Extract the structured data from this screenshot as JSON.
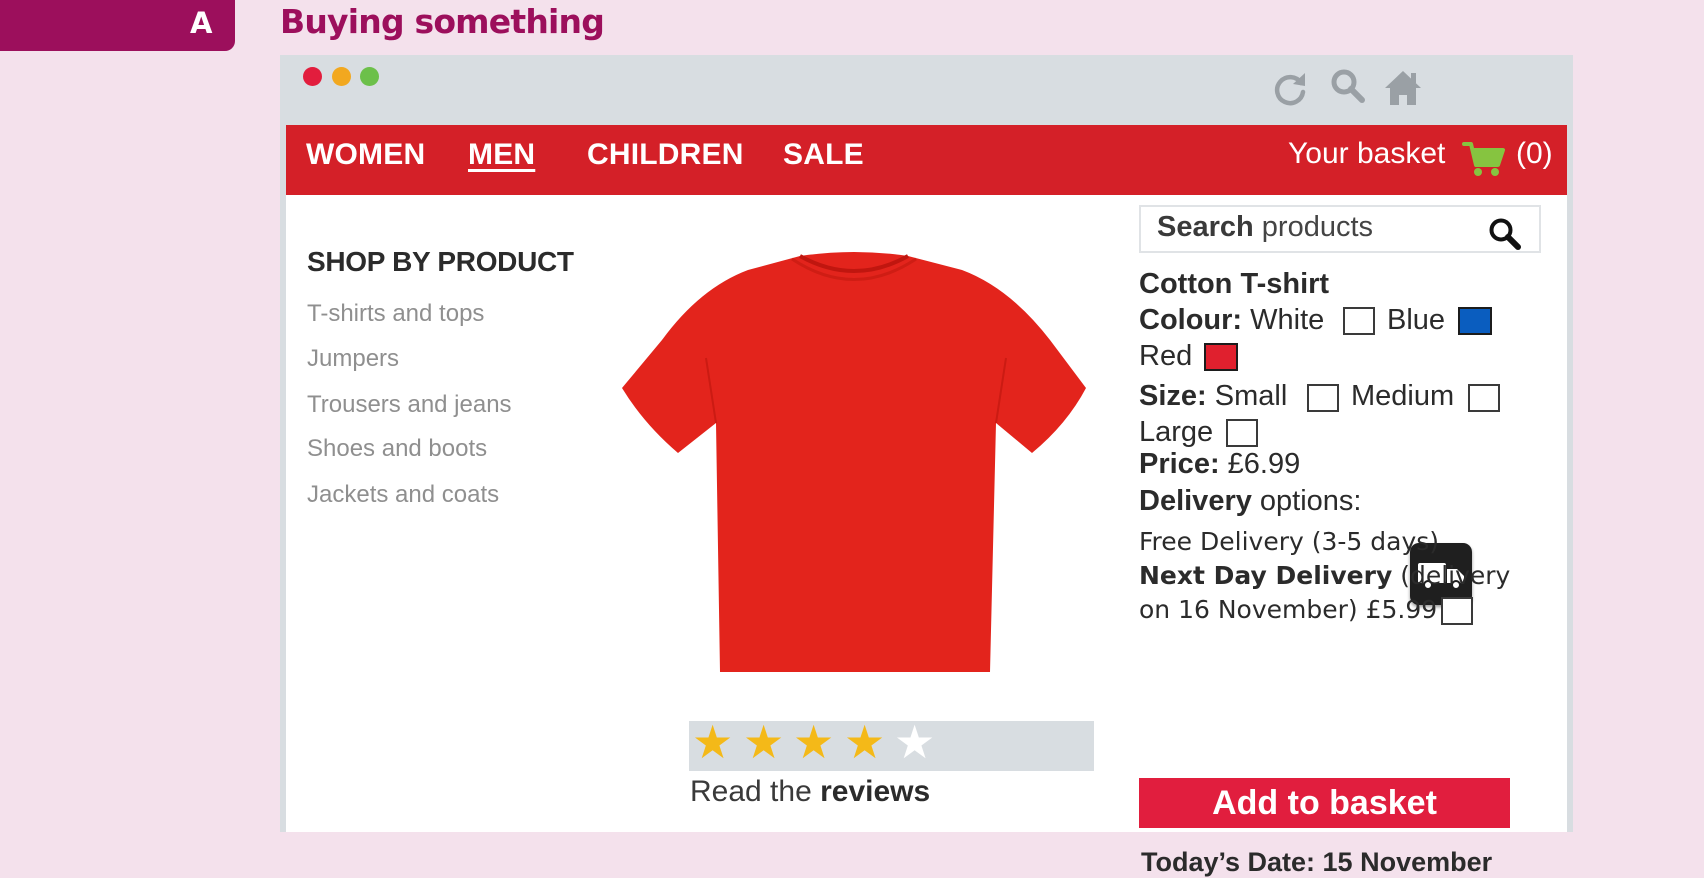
{
  "section": {
    "letter": "A",
    "title": "Buying something"
  },
  "browser": {
    "toolbar_icons": [
      "refresh-icon",
      "search-icon",
      "home-icon"
    ],
    "window_dots": [
      "#e21d3d",
      "#f2a81f",
      "#6cc04a"
    ]
  },
  "nav": {
    "items": [
      {
        "label": "WOMEN",
        "active": false
      },
      {
        "label": "MEN",
        "active": true
      },
      {
        "label": "CHILDREN",
        "active": false
      },
      {
        "label": "SALE",
        "active": false
      }
    ],
    "basket_label": "Your basket",
    "basket_count": "(0)",
    "color": "#d42028"
  },
  "search": {
    "bold": "Search",
    "rest": " products"
  },
  "categories": {
    "heading": "SHOP BY PRODUCT",
    "items": [
      "T-shirts and tops",
      "Jumpers",
      "Trousers and jeans",
      "Shoes and boots",
      "Jackets and coats"
    ]
  },
  "product": {
    "name": "Cotton T-shirt",
    "image_color": "#e3241c",
    "colour_label": "Colour:",
    "colours": [
      {
        "name": "White",
        "swatch": "#ffffff"
      },
      {
        "name": "Blue",
        "swatch": "#0a5dbf"
      },
      {
        "name": "Red",
        "swatch": "#e0202e"
      }
    ],
    "size_label": "Size:",
    "sizes": [
      "Small",
      "Medium",
      "Large"
    ],
    "price_label": "Price:",
    "price": "£6.99",
    "delivery_label": "Delivery",
    "delivery_rest": "options:",
    "free_delivery": "Free Delivery (3-5 days)",
    "next_day_bold": "Next Day Delivery",
    "next_day_line1_rest": "(delivery",
    "next_day_line2": "on 16 November) £5.99",
    "rating": {
      "stars_filled": 4,
      "stars_total": 5
    },
    "reviews_prefix": "Read the ",
    "reviews_bold": "reviews",
    "add_button": "Add to basket",
    "today_label": "Today’s Date: 15 November"
  }
}
